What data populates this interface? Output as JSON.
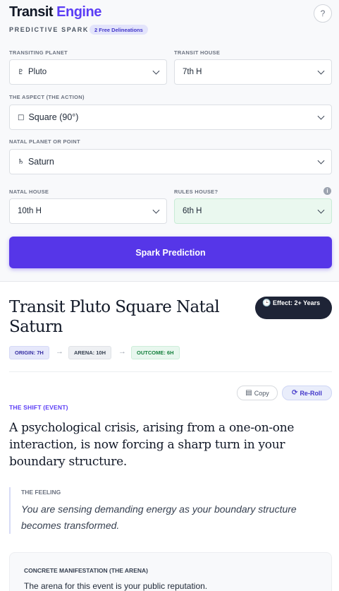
{
  "brand": {
    "name_part1": "Transit",
    "name_part2": "Engine"
  },
  "header": {
    "subtitle": "PREDICTIVE SPARK",
    "free_badge": "2 Free Delineations",
    "help_label": "?"
  },
  "form": {
    "transiting_planet": {
      "label": "TRANSITING PLANET",
      "glyph": "♇",
      "value": "Pluto"
    },
    "transit_house": {
      "label": "TRANSIT HOUSE",
      "value": "7th H"
    },
    "aspect": {
      "label": "THE ASPECT (THE ACTION)",
      "glyph": "□",
      "value": "Square (90°)"
    },
    "natal_planet": {
      "label": "NATAL PLANET OR POINT",
      "glyph": "♄",
      "value": "Saturn"
    },
    "natal_house": {
      "label": "NATAL HOUSE",
      "value": "10th H"
    },
    "rules_house": {
      "label": "RULES HOUSE?",
      "value": "6th H",
      "info": "i"
    },
    "submit_label": "Spark Prediction"
  },
  "result": {
    "title": "Transit Pluto Square Natal Saturn",
    "effect_label": "Effect: 2+ Years",
    "chips": {
      "origin": "ORIGIN: 7H",
      "arena": "ARENA: 10H",
      "outcome": "OUTCOME: 6H",
      "arrow": "→"
    },
    "copy_label": "Copy",
    "reroll_label": "Re-Roll",
    "shift_label": "THE SHIFT (EVENT)",
    "shift_text": "A psychological crisis, arising from a one-on-one interaction, is now forcing a sharp turn in your boundary structure.",
    "feeling_label": "THE FEELING",
    "feeling_text": "You are sensing demanding energy as your boundary structure becomes transformed.",
    "arena_label": "CONCRETE MANIFESTATION (THE ARENA)",
    "arena_text": "The arena for this event is your public reputation."
  },
  "colors": {
    "accent": "#5636e8",
    "dark_pill": "#1e2436",
    "green_tint": "#eaf8ef"
  },
  "icons": {
    "help": "question-icon",
    "chevron": "chevron-down-icon",
    "info": "info-icon",
    "clock": "clock-icon",
    "copy": "copy-icon",
    "reroll": "refresh-icon"
  }
}
